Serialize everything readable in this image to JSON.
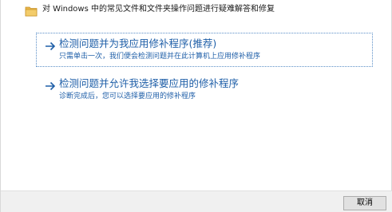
{
  "header": {
    "icon": "folder-icon",
    "title": "对 Windows 中的常见文件和文件夹操作问题进行疑难解答和修复"
  },
  "options": [
    {
      "icon": "arrow-right-icon",
      "title": "检测问题并为我应用修补程序(推荐)",
      "description": "只需单击一次，我们便会检测问题并在此计算机上应用修补程序"
    },
    {
      "icon": "arrow-right-icon",
      "title": "检测问题并允许我选择要应用的修补程序",
      "description": "诊断完成后，您可以选择要应用的修补程序"
    }
  ],
  "footer": {
    "cancel_label": "取消"
  },
  "colors": {
    "link": "#1f5fa8",
    "focus_border": "#5b8fc7",
    "footer_bg": "#f0f0f0",
    "folder": "#e8b548"
  }
}
